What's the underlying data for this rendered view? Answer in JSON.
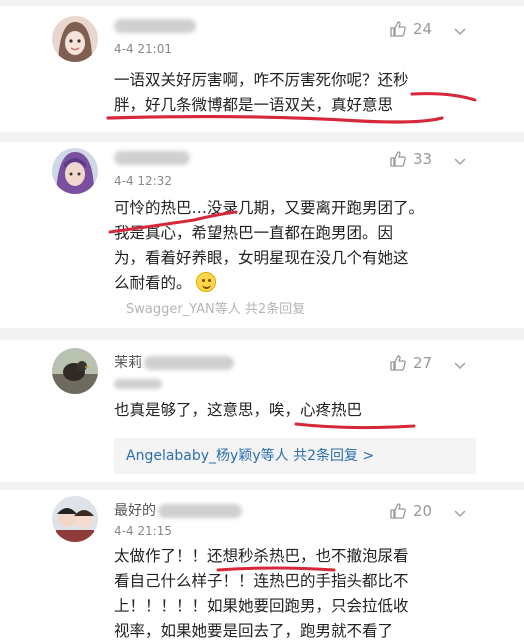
{
  "comments": [
    {
      "time": "4-4 21:01",
      "likes": "24",
      "text_lines": [
        "一语双关好厉害啊，咋不厉害死你呢？还秒",
        "胖，好几条微博都是一语双关，真好意思"
      ]
    },
    {
      "time": "4-4 12:32",
      "likes": "33",
      "text_lines": [
        "可怜的热巴…没录几期，又要离开跑男团了。",
        "我是真心，希望热巴一直都在跑男团。因",
        "为，看着好养眼，女明星现在没几个有她这",
        "么耐看的。"
      ],
      "replies_faded": "Swagger_YAN等人 共2条回复"
    },
    {
      "name_prefix": "茉莉",
      "likes": "27",
      "text_lines": [
        "也真是够了，这意思，唉，心疼热巴"
      ],
      "replies": {
        "names": "Angelababy_杨y颖y等人",
        "more": "共2条回复",
        "arrow": ">"
      }
    },
    {
      "name_prefix": "最好的",
      "time": "4-4 21:15",
      "likes": "20",
      "text_lines": [
        "太做作了！！还想秒杀热巴，也不撤泡尿看",
        "看自己什么样子！！连热巴的手指头都比不",
        "上！！！！！如果她要回跑男，只会拉低收",
        "视率，如果她要是回去了，跑男就不看了"
      ]
    }
  ],
  "icons": {
    "like": "thumbs-up-icon",
    "menu": "chevron-down-icon",
    "emoji": "smiling-face-emoji"
  },
  "colors": {
    "underline": "#d6283a",
    "link": "#2a6fb0"
  }
}
